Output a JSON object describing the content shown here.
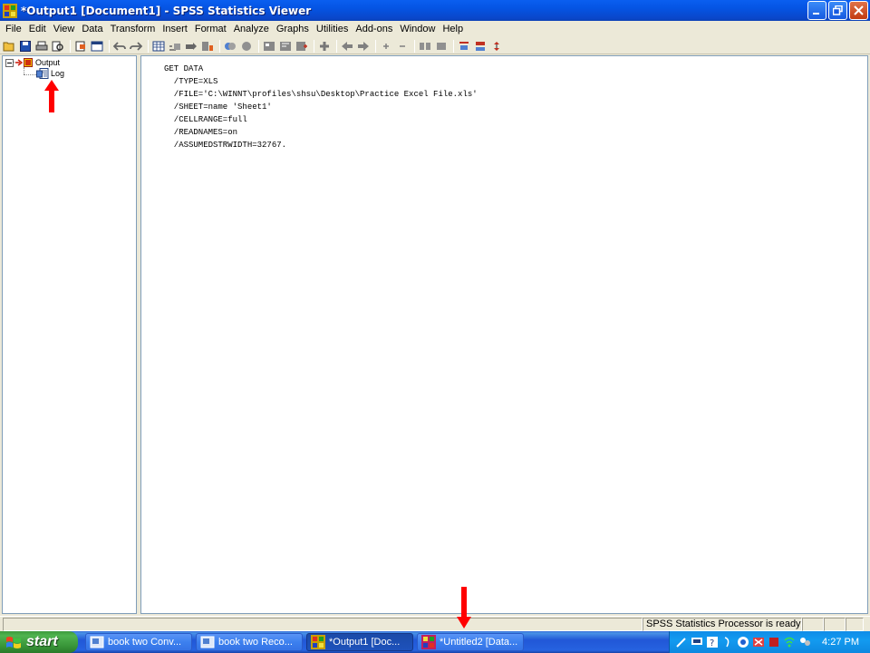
{
  "window": {
    "title": "*Output1 [Document1] - SPSS Statistics Viewer"
  },
  "menu": [
    {
      "label": "File"
    },
    {
      "label": "Edit"
    },
    {
      "label": "View"
    },
    {
      "label": "Data"
    },
    {
      "label": "Transform"
    },
    {
      "label": "Insert"
    },
    {
      "label": "Format"
    },
    {
      "label": "Analyze"
    },
    {
      "label": "Graphs"
    },
    {
      "label": "Utilities"
    },
    {
      "label": "Add-ons"
    },
    {
      "label": "Window"
    },
    {
      "label": "Help"
    }
  ],
  "outline": {
    "root_label": "Output",
    "child_label": "Log"
  },
  "syntax_lines": [
    "GET DATA",
    "  /TYPE=XLS",
    "  /FILE='C:\\WINNT\\profiles\\shsu\\Desktop\\Practice Excel File.xls'",
    "  /SHEET=name 'Sheet1'",
    "  /CELLRANGE=full",
    "  /READNAMES=on",
    "  /ASSUMEDSTRWIDTH=32767."
  ],
  "status": {
    "processor": "SPSS Statistics  Processor is ready"
  },
  "taskbar": {
    "start_label": "start",
    "tasks": [
      {
        "label": "book two Conv..."
      },
      {
        "label": "book two Reco..."
      },
      {
        "label": "*Output1 [Doc..."
      },
      {
        "label": "*Untitled2 [Data..."
      }
    ],
    "clock": "4:27 PM"
  },
  "colors": {
    "annotation_arrow": "#ff0000",
    "title_bar": "#0554e3",
    "taskbar": "#2157d7"
  }
}
